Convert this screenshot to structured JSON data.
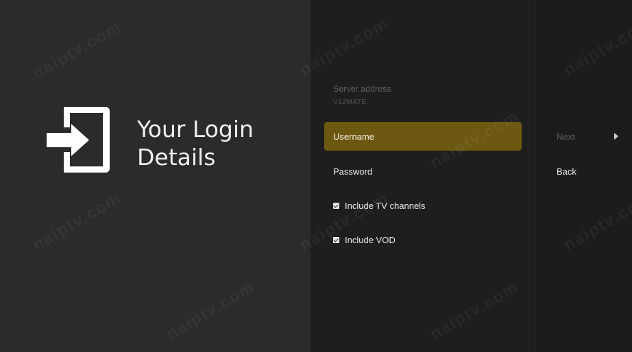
{
  "guidance": {
    "icon": "login-enter-icon",
    "title_line1": "Your Login",
    "title_line2": "Details"
  },
  "server": {
    "label": "Server address",
    "value": "V12MATE"
  },
  "actions": [
    {
      "label": "Username",
      "focused": true
    },
    {
      "label": "Password",
      "focused": false
    },
    {
      "label": "Include TV channels",
      "checked": true
    },
    {
      "label": "Include VOD",
      "checked": true
    }
  ],
  "buttons": {
    "next_label": "Next",
    "back_label": "Back",
    "next_icon": "play-arrow-icon"
  },
  "watermark": "naiptv.com",
  "colors": {
    "focus_highlight": "#6d5812",
    "left_panel": "#2b2b2b",
    "middle_panel": "#1e1e1e"
  }
}
